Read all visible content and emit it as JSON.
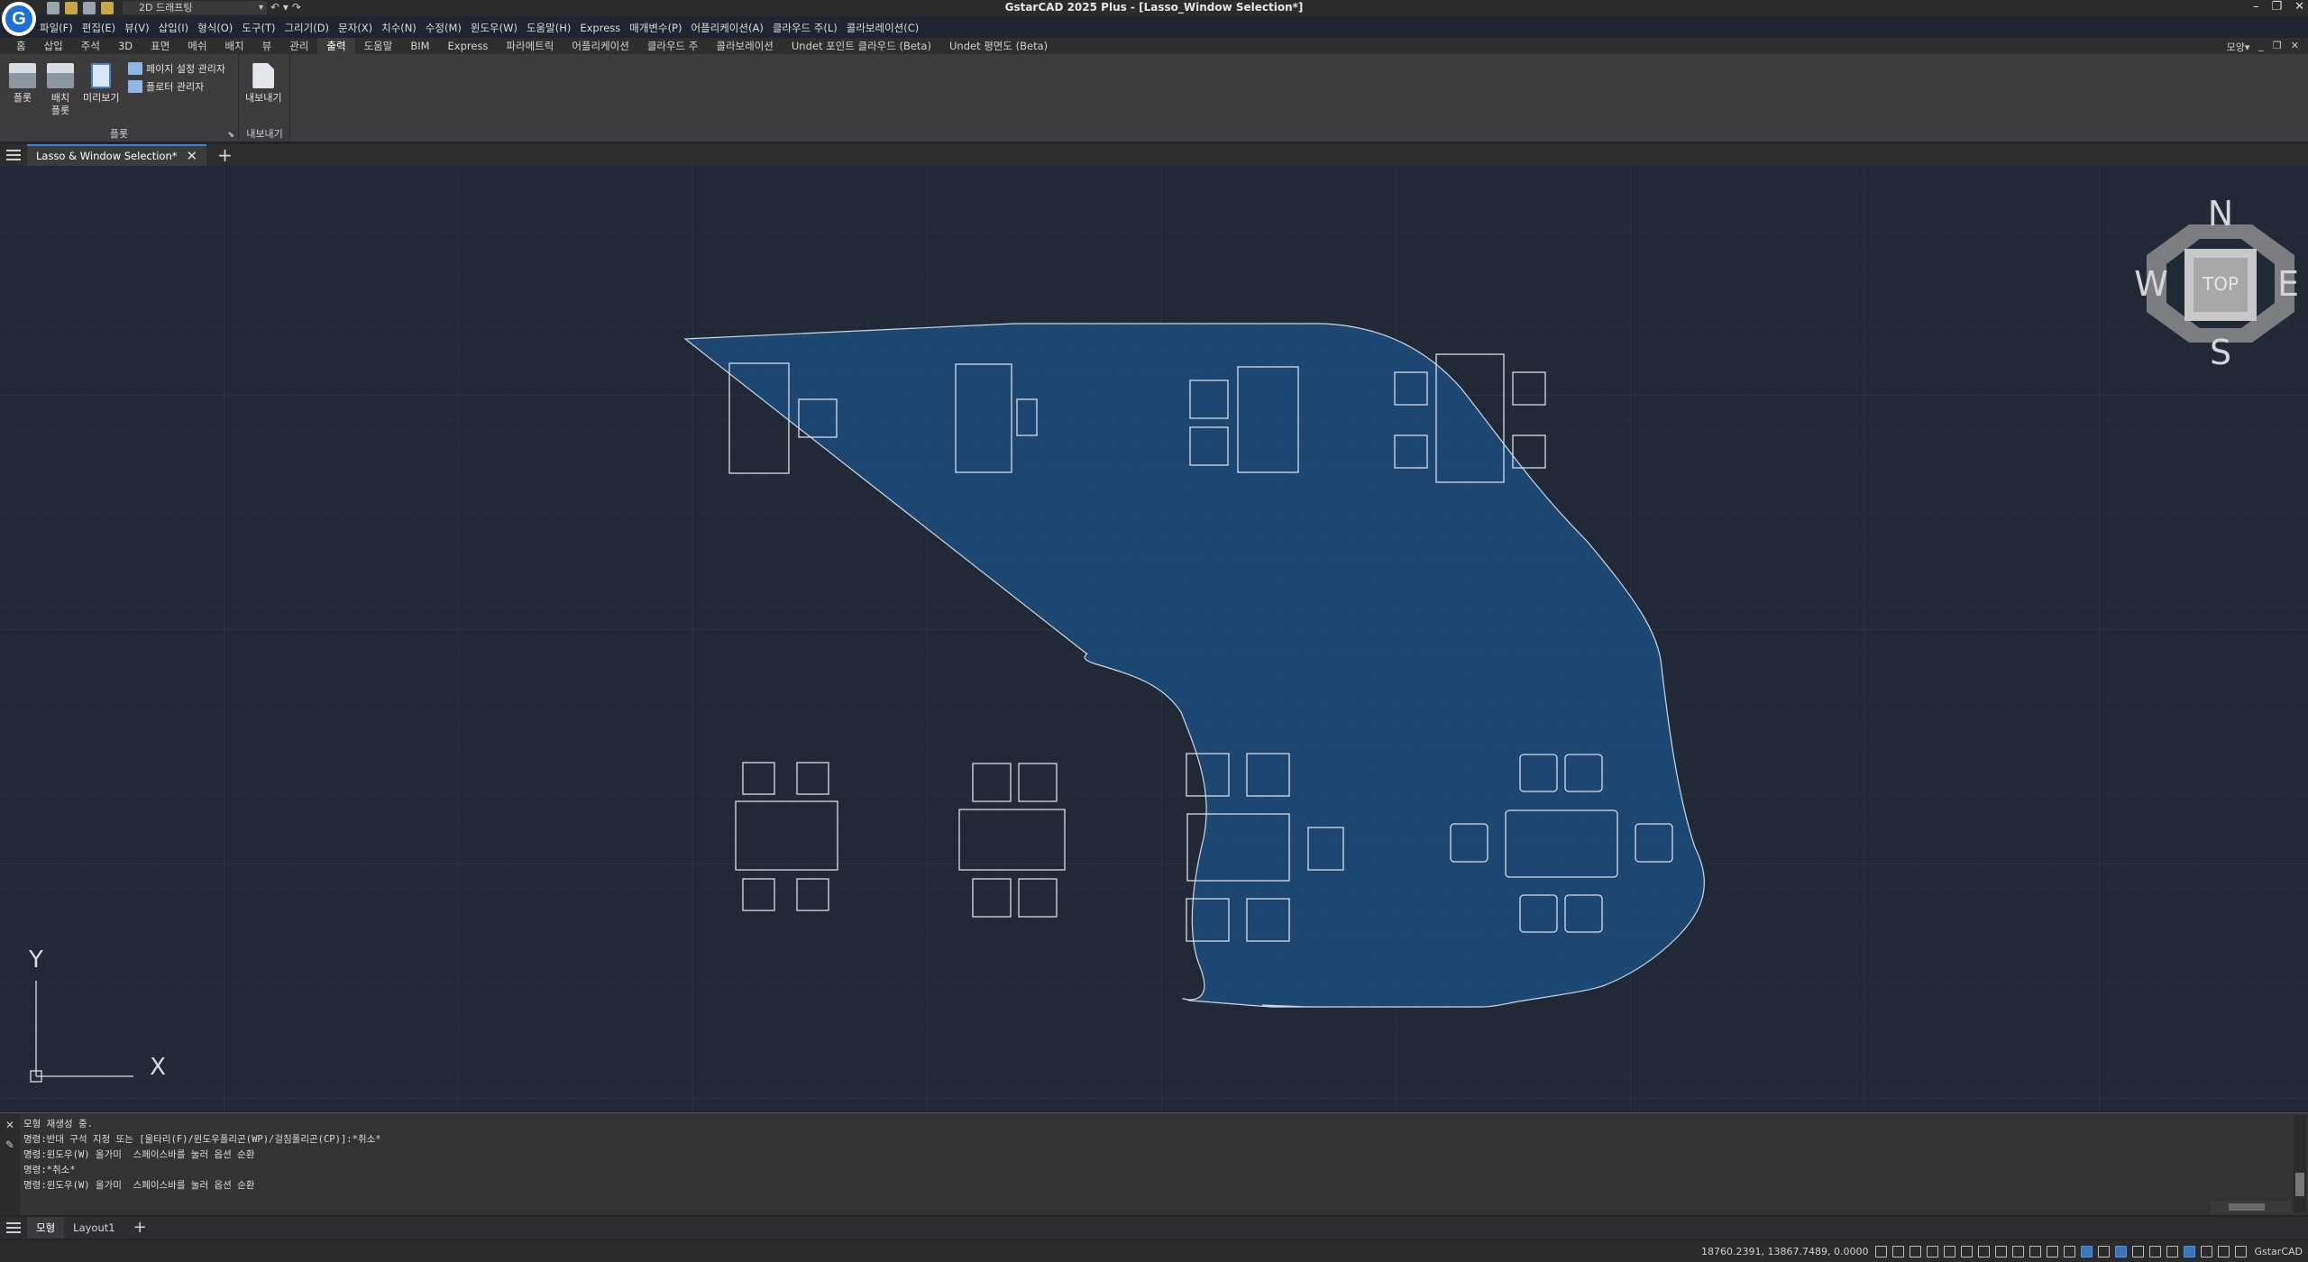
{
  "titlebar": {
    "workspace": "2D 드래프팅",
    "undo": "↶ ▾",
    "redo": "↷",
    "title": "GstarCAD 2025 Plus - [Lasso_Window Selection*]",
    "minimize": "–",
    "restore": "❐",
    "close": "✕"
  },
  "menubar": [
    "파일(F)",
    "편집(E)",
    "뷰(V)",
    "삽입(I)",
    "형식(O)",
    "도구(T)",
    "그리기(D)",
    "문자(X)",
    "치수(N)",
    "수정(M)",
    "윈도우(W)",
    "도움말(H)",
    "Express",
    "매개변수(P)",
    "어플리케이션(A)",
    "클라우드 주(L)",
    "콜라보레이션(C)"
  ],
  "ribbon_tabs": [
    "홈",
    "삽입",
    "주석",
    "3D",
    "표면",
    "메쉬",
    "배치",
    "뷰",
    "관리",
    "출력",
    "도움말",
    "BIM",
    "Express",
    "파라메트릭",
    "어플리케이션",
    "클라우드 주",
    "콜라보레이션",
    "Undet 포인트 클라우드 (Beta)",
    "Undet 평면도 (Beta)"
  ],
  "ribbon_active_tab": "출력",
  "ribbon_right": {
    "mode": "모양▾",
    "min": "_",
    "restore": "❐",
    "close": "✕"
  },
  "ribbon": {
    "plot_panel": {
      "label": "플롯",
      "plot_button": "플롯",
      "batch_plot_line1": "배치",
      "batch_plot_line2": "플롯",
      "preview_button": "미리보기",
      "page_setup": "페이지 설정 관리자",
      "plotter_manager": "플로터 관리자"
    },
    "export_panel": {
      "label": "내보내기",
      "export_button": "내보내기"
    }
  },
  "doc_tab": {
    "title": "Lasso & Window Selection*",
    "close": "✕",
    "add": "+"
  },
  "viewcube": {
    "n": "N",
    "s": "S",
    "e": "E",
    "w": "W",
    "face": "TOP"
  },
  "ucs": {
    "y": "Y",
    "x": "X"
  },
  "command_history": [
    "모형 재생성 중.",
    "명령:반대 구석 지정 또는 [울타리(F)/윈도우폴리곤(WP)/걸침폴리곤(CP)]:*취소*",
    "명령:윈도우(W) 올가미  스페이스바를 눌러 옵션 순환",
    "명령:*취소*",
    "명령:윈도우(W) 올가미  스페이스바를 눌러 옵션 순환"
  ],
  "layout_tabs": [
    "모형",
    "Layout1"
  ],
  "layout_active": "모형",
  "layout_add": "+",
  "status": {
    "coords": "18760.2391, 13867.7489, 0.0000",
    "app": "GstarCAD"
  },
  "colors": {
    "canvas": "#212836",
    "lasso_fill": "#1d4a78",
    "lasso_stroke": "#cfd8e2",
    "accent": "#3b83d8"
  }
}
